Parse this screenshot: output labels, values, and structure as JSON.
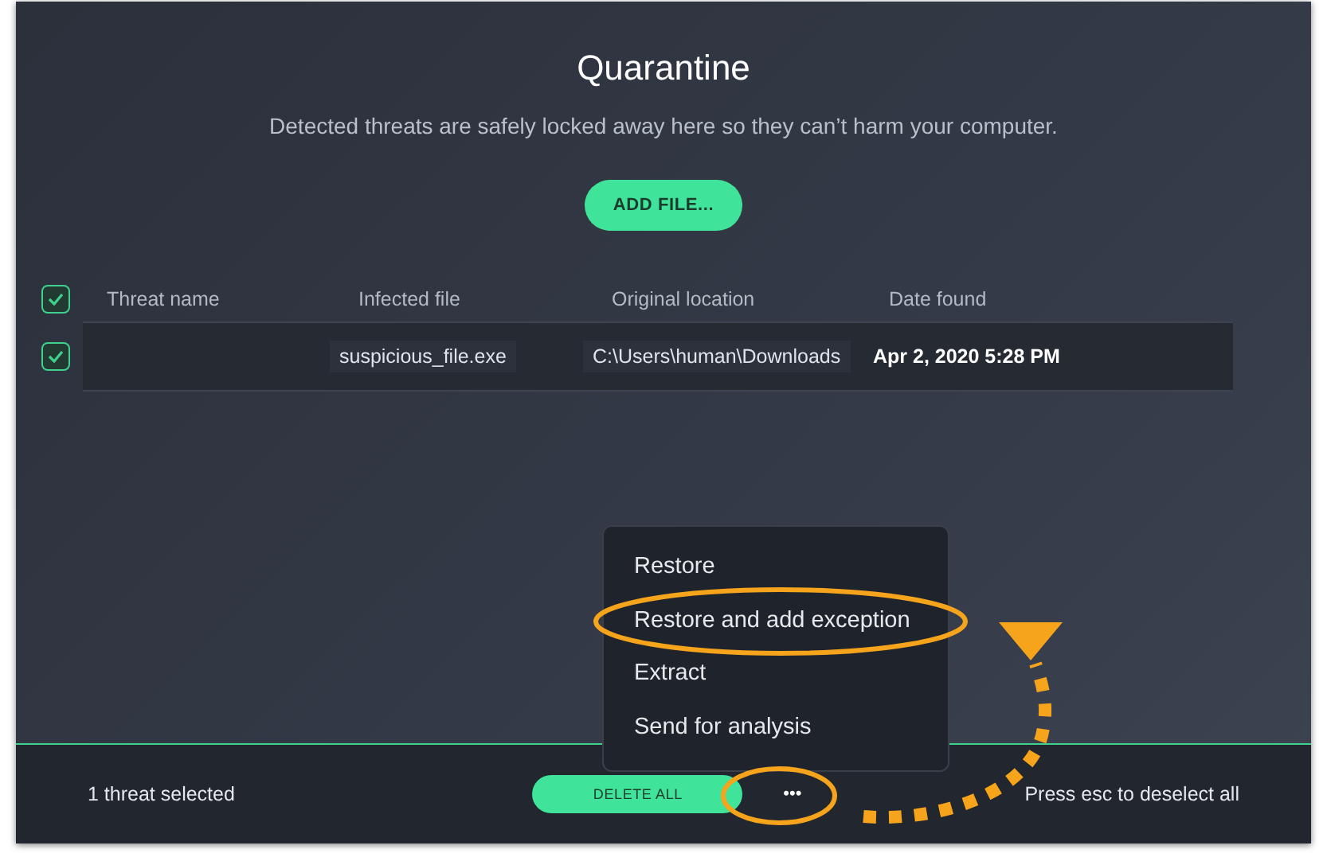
{
  "window": {
    "title": "Quarantine",
    "subtitle": "Detected threats are safely locked away here so they can’t harm your computer.",
    "add_button": "ADD FILE..."
  },
  "table": {
    "select_all_checked": true,
    "columns": [
      "Threat name",
      "Infected file",
      "Original location",
      "Date found"
    ],
    "rows": [
      {
        "checked": true,
        "infected_file": "suspicious_file.exe",
        "original_location": "C:\\Users\\human\\Downloads",
        "date_found": "Apr 2, 2020 5:28 PM"
      }
    ]
  },
  "context_menu": {
    "items": [
      {
        "label": "Restore",
        "circled": false
      },
      {
        "label": "Restore and add exception",
        "circled": true
      },
      {
        "label": "Extract",
        "circled": false
      },
      {
        "label": "Send for analysis",
        "circled": false
      }
    ]
  },
  "footer": {
    "selection_text": "1 threat selected",
    "delete_button": "DELETE ALL",
    "more_button": {
      "label": "•••",
      "circled": true
    },
    "hint": "Press esc to deselect all"
  }
}
